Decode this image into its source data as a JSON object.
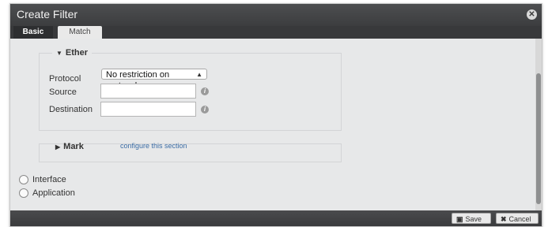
{
  "dialog": {
    "title": "Create Filter",
    "close_icon": "close-icon"
  },
  "tabs": [
    {
      "label": "Basic",
      "active": false
    },
    {
      "label": "Match",
      "active": true
    }
  ],
  "ether": {
    "legend": "Ether",
    "protocol_label": "Protocol",
    "protocol_value": "No restriction on protocols",
    "source_label": "Source",
    "source_value": "",
    "destination_label": "Destination",
    "destination_value": ""
  },
  "mark": {
    "legend": "Mark",
    "link": "configure this section"
  },
  "radios": [
    {
      "label": "Interface",
      "checked": false
    },
    {
      "label": "Application",
      "checked": false
    }
  ],
  "footer": {
    "save_label": "Save",
    "cancel_label": "Cancel"
  },
  "colors": {
    "titlebar": "#3c3d3f",
    "dialog_bg": "#e7e8e9",
    "link": "#3b6da6"
  }
}
